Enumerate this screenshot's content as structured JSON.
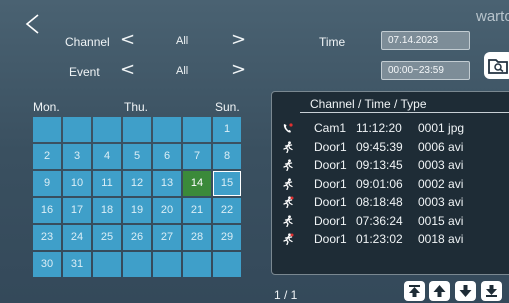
{
  "brand": "warto",
  "filters": {
    "channel_label": "Channel",
    "channel_value": "All",
    "event_label": "Event",
    "event_value": "All",
    "time_label": "Time",
    "date_value": "07.14.2023",
    "time_range_value": "00:00~23:59",
    "prev_glyph": "<",
    "next_glyph": ">"
  },
  "calendar": {
    "headers": [
      "Mon.",
      "Thu.",
      "Sun."
    ],
    "cells": [
      "",
      "",
      "",
      "",
      "",
      "",
      "1",
      "2",
      "3",
      "4",
      "5",
      "6",
      "7",
      "8",
      "9",
      "10",
      "11",
      "12",
      "13",
      "14",
      "15",
      "16",
      "17",
      "18",
      "19",
      "20",
      "21",
      "22",
      "23",
      "24",
      "25",
      "26",
      "27",
      "28",
      "29",
      "30",
      "31",
      "",
      "",
      "",
      "",
      ""
    ],
    "today": "14",
    "selected": "15",
    "cell_color": "#3f9fc9",
    "today_color": "#3b8a3a"
  },
  "records": {
    "header": "Channel / Time / Type",
    "rows": [
      {
        "icon": "phone-icon",
        "channel": "Cam1",
        "time": "11:12:20",
        "type": "0001 jpg"
      },
      {
        "icon": "running-person-icon",
        "channel": "Door1",
        "time": "09:45:39",
        "type": "0006 avi"
      },
      {
        "icon": "running-person-icon",
        "channel": "Door1",
        "time": "09:13:45",
        "type": "0003 avi"
      },
      {
        "icon": "running-person-icon",
        "channel": "Door1",
        "time": "09:01:06",
        "type": "0002 avi"
      },
      {
        "icon": "running-person-icon",
        "channel": "Door1",
        "time": "08:18:48",
        "type": "0003 avi"
      },
      {
        "icon": "running-person-icon",
        "channel": "Door1",
        "time": "07:36:24",
        "type": "0015 avi"
      },
      {
        "icon": "running-person-icon",
        "channel": "Door1",
        "time": "01:23:02",
        "type": "0018 avi"
      }
    ],
    "page": "1 / 1"
  },
  "icons": {
    "back": "back-icon",
    "search": "folder-search-icon",
    "nav": [
      "first-page-icon",
      "page-up-icon",
      "page-down-icon",
      "last-page-icon"
    ]
  }
}
